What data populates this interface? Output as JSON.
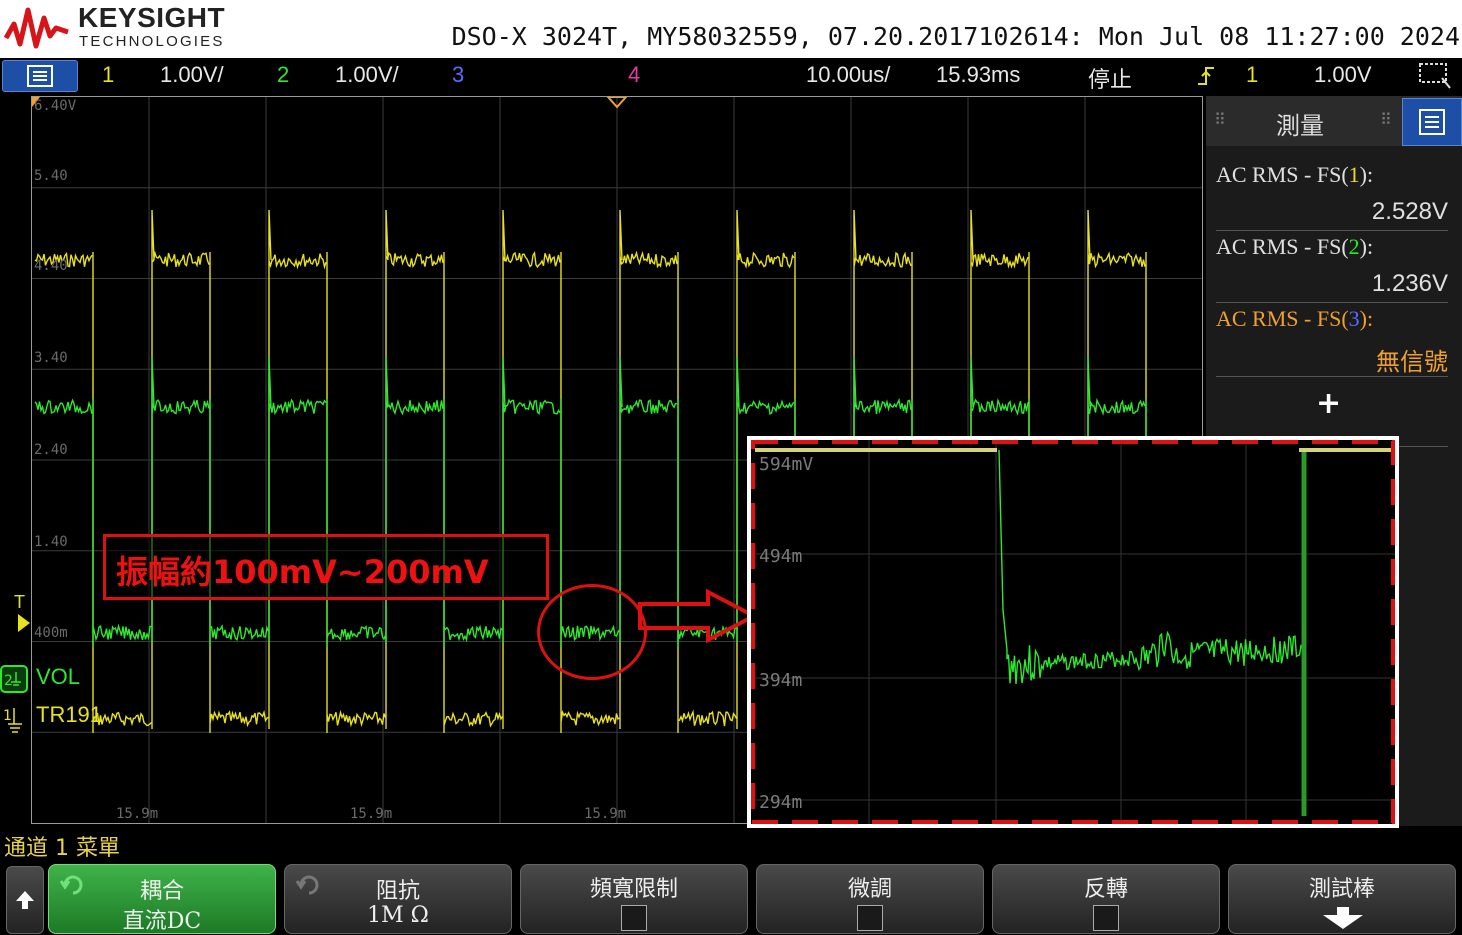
{
  "brand": {
    "name": "KEYSIGHT",
    "sub": "TECHNOLOGIES"
  },
  "device_info": "DSO-X 3024T, MY58032559, 07.20.2017102614: Mon Jul 08 11:27:00 2024",
  "status": {
    "ch1_num": "1",
    "ch1_scale": "1.00V/",
    "ch2_num": "2",
    "ch2_scale": "1.00V/",
    "ch3_num": "3",
    "ch4_num": "4",
    "timebase": "10.00us/",
    "delay": "15.93ms",
    "run_state": "停止",
    "trig_channel": "1",
    "trig_level": "1.00V"
  },
  "colors": {
    "ch1": "#e8e11e",
    "ch2": "#2ee82e",
    "ch3": "#5b6cff",
    "ch4": "#e23aa2",
    "accent": "#1e4fa6",
    "annotation": "#dd1111"
  },
  "graticule": {
    "y_labels": [
      "6.40V",
      "5.40",
      "4.40",
      "3.40",
      "2.40",
      "1.40",
      "400m"
    ],
    "x_labels": [
      "15.9m",
      "15.9m",
      "15.9m"
    ],
    "ch_labels": {
      "ch2": "VOL",
      "ch1": "TR191",
      "trig_marker": "T"
    }
  },
  "annotation": {
    "text": "振幅約100mV~200mV"
  },
  "measure_panel": {
    "title": "測量",
    "items": [
      {
        "name": "AC RMS - FS",
        "channel": "1",
        "value": "2.528V",
        "color": "#e0e0e0"
      },
      {
        "name": "AC RMS - FS",
        "channel": "2",
        "value": "1.236V",
        "color": "#e0e0e0"
      },
      {
        "name": "AC RMS - FS",
        "channel": "3",
        "value": "無信號",
        "color": "#f0a030"
      }
    ],
    "add_label": "+"
  },
  "zoom": {
    "y_labels": [
      "594mV",
      "494m",
      "394m",
      "294m"
    ]
  },
  "channel_menu_title": "通道 1 菜單",
  "softkeys": [
    {
      "l1": "耦合",
      "l2": "直流DC",
      "active": true
    },
    {
      "l1": "阻抗",
      "l2": "1M Ω"
    },
    {
      "l1": "頻寬限制",
      "checkbox": true
    },
    {
      "l1": "微調",
      "checkbox": true
    },
    {
      "l1": "反轉",
      "checkbox": true
    },
    {
      "l1": "測試棒"
    }
  ],
  "icons": [
    "menu-icon",
    "trigger-edge-icon",
    "zoom-box-icon",
    "up-arrow-icon",
    "undo-icon",
    "down-arrow-icon"
  ]
}
